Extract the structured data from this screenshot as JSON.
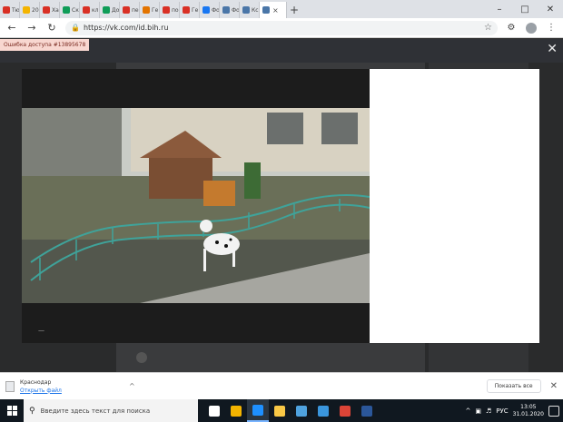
{
  "browser": {
    "tabs": [
      {
        "title": "Тю",
        "color": "#d93025"
      },
      {
        "title": "202",
        "color": "#f4b400"
      },
      {
        "title": "Ха",
        "color": "#d93025"
      },
      {
        "title": "Ске",
        "color": "#0f9d58"
      },
      {
        "title": "кл",
        "color": "#d93025"
      },
      {
        "title": "До",
        "color": "#0f9d58"
      },
      {
        "title": "пе",
        "color": "#d93025"
      },
      {
        "title": "Ге",
        "color": "#e37400"
      },
      {
        "title": "по",
        "color": "#d93025"
      },
      {
        "title": "Ге",
        "color": "#d93025"
      },
      {
        "title": "Фо",
        "color": "#1877f2"
      },
      {
        "title": "Фо",
        "color": "#4a76a8"
      },
      {
        "title": "Кс",
        "color": "#4a76a8"
      },
      {
        "title": "",
        "color": "#4a76a8",
        "active": true
      }
    ],
    "new_tab": "+",
    "window_controls": {
      "minimize": "–",
      "maximize": "□",
      "close": "✕"
    },
    "back": "←",
    "forward": "→",
    "reload": "↻",
    "url": "https://vk.com/id.bih.ru",
    "star": "☆"
  },
  "vk": {
    "error_toast": "Ошибка доступа #13895678",
    "close_viewer": "✕",
    "viewer_footer": "—"
  },
  "downloads": {
    "file_name": "Краснодар",
    "file_link": "Открыть файл",
    "chevron": "^",
    "show_all": "Показать все",
    "close": "✕"
  },
  "taskbar": {
    "search_placeholder": "Введите здесь текст для поиска",
    "apps": [
      {
        "name": "task-view",
        "color": "#ffffff"
      },
      {
        "name": "store",
        "color": "#f4b400"
      },
      {
        "name": "edge",
        "color": "#1e90ff",
        "active": true
      },
      {
        "name": "explorer",
        "color": "#f9c846"
      },
      {
        "name": "store-bag",
        "color": "#4fa3e0"
      },
      {
        "name": "mail",
        "color": "#3a96dd"
      },
      {
        "name": "chrome",
        "color": "#db4437"
      },
      {
        "name": "word",
        "color": "#2b579a"
      }
    ],
    "lang": "РУС",
    "time": "13:05",
    "date": "31.01.2020"
  }
}
